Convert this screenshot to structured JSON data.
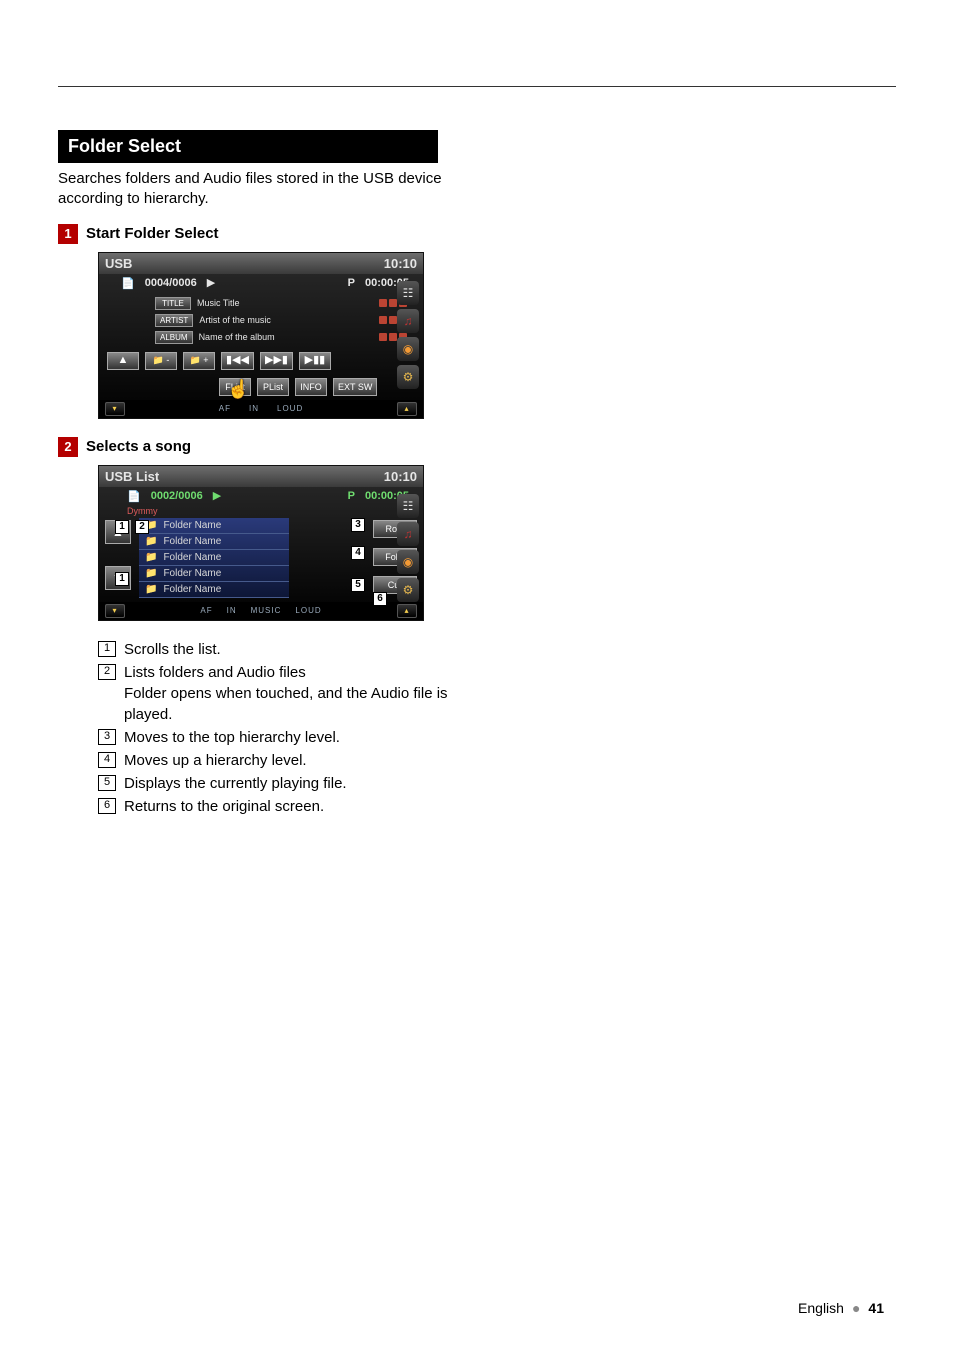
{
  "section": {
    "title": "Folder Select",
    "description": "Searches folders and Audio files stored in the USB device according to hierarchy."
  },
  "step1": {
    "number": "1",
    "title": "Start Folder Select"
  },
  "usb_screen": {
    "title": "USB",
    "clock": "10:10",
    "track_index": "0004/0006",
    "mode": "P",
    "time": "00:00:05",
    "meta": {
      "title_btn": "TITLE",
      "title_val": "Music Title",
      "artist_btn": "ARTIST",
      "artist_val": "Artist of the music",
      "album_btn": "ALBUM",
      "album_val": "Name of the album"
    },
    "transport": {
      "eject": "▲",
      "fol_minus": "📁 -",
      "fol_plus": "📁 +",
      "prev": "▮◀◀",
      "next": "▶▶▮",
      "playpause": "▶▮▮",
      "flist": "FList",
      "plist": "PList",
      "info": "INFO",
      "extsw": "EXT SW"
    },
    "footer": {
      "af": "AF",
      "in_": "IN",
      "music": "",
      "loud": "LOUD"
    }
  },
  "step2": {
    "number": "2",
    "title": "Selects a song"
  },
  "usb_list_screen": {
    "title": "USB List",
    "clock": "10:10",
    "track_index": "0002/0006",
    "mode": "P",
    "time": "00:00:05",
    "dummy": "Dymmy",
    "items": [
      "Folder Name",
      "Folder Name",
      "Folder Name",
      "Folder Name",
      "Folder Name"
    ],
    "right_buttons": {
      "root": "Root",
      "fol_up": "Fol ↑",
      "cur": "Cur"
    },
    "return_icon": "↩",
    "footer": {
      "af": "AF",
      "in_": "IN",
      "music": "MUSIC",
      "loud": "LOUD"
    }
  },
  "legend": {
    "1": "Scrolls the list.",
    "2a": "Lists folders and Audio files",
    "2b": "Folder opens when touched, and the Audio file is played.",
    "3": "Moves to the top hierarchy level.",
    "4": "Moves up a hierarchy level.",
    "5": "Displays the currently playing file.",
    "6": "Returns to the original screen."
  },
  "callouts": {
    "c1": "1",
    "c2": "2",
    "c3": "3",
    "c4": "4",
    "c5": "5",
    "c6": "6"
  },
  "page_footer": {
    "lang": "English",
    "page": "41"
  }
}
